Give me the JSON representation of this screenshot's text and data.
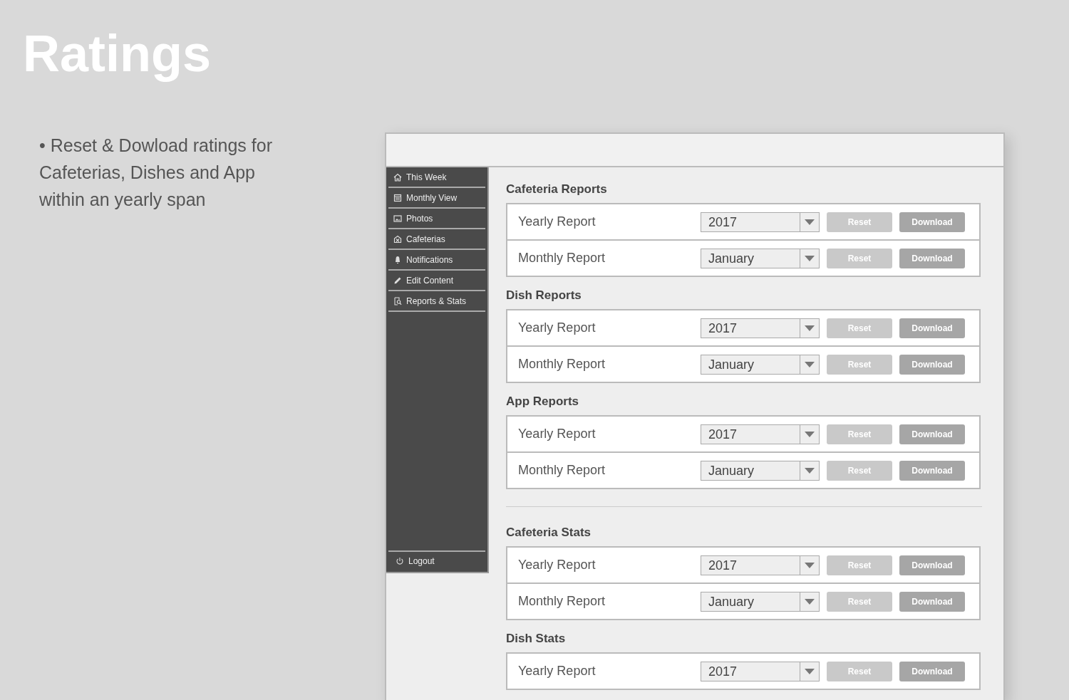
{
  "title": "Ratings",
  "description": "• Reset & Dowload ratings for Cafeterias, Dishes and App within an yearly span",
  "sidebar": {
    "items": [
      {
        "label": "This Week"
      },
      {
        "label": "Monthly View"
      },
      {
        "label": "Photos"
      },
      {
        "label": "Cafeterias"
      },
      {
        "label": "Notifications"
      },
      {
        "label": "Edit Content"
      },
      {
        "label": "Reports & Stats"
      }
    ],
    "logout": {
      "label": "Logout"
    }
  },
  "groups": [
    {
      "sections": [
        {
          "heading": "Cafeteria Reports",
          "rows": [
            {
              "label": "Yearly Report",
              "value": "2017",
              "reset": {
                "label": "Reset",
                "disabled": true
              },
              "download": {
                "label": "Download",
                "disabled": false
              }
            },
            {
              "label": "Monthly Report",
              "value": "January",
              "reset": {
                "label": "Reset",
                "disabled": true
              },
              "download": {
                "label": "Download",
                "disabled": false
              }
            }
          ]
        },
        {
          "heading": "Dish Reports",
          "rows": [
            {
              "label": "Yearly Report",
              "value": "2017",
              "reset": {
                "label": "Reset",
                "disabled": true
              },
              "download": {
                "label": "Download",
                "disabled": false
              }
            },
            {
              "label": "Monthly Report",
              "value": "January",
              "reset": {
                "label": "Reset",
                "disabled": true
              },
              "download": {
                "label": "Download",
                "disabled": false
              }
            }
          ]
        },
        {
          "heading": "App Reports",
          "rows": [
            {
              "label": "Yearly Report",
              "value": "2017",
              "reset": {
                "label": "Reset",
                "disabled": true
              },
              "download": {
                "label": "Download",
                "disabled": false
              }
            },
            {
              "label": "Monthly Report",
              "value": "January",
              "reset": {
                "label": "Reset",
                "disabled": true
              },
              "download": {
                "label": "Download",
                "disabled": false
              }
            }
          ]
        }
      ]
    },
    {
      "sections": [
        {
          "heading": "Cafeteria Stats",
          "rows": [
            {
              "label": "Yearly Report",
              "value": "2017",
              "reset": {
                "label": "Reset",
                "disabled": true
              },
              "download": {
                "label": "Download",
                "disabled": false
              }
            },
            {
              "label": "Monthly Report",
              "value": "January",
              "reset": {
                "label": "Reset",
                "disabled": true
              },
              "download": {
                "label": "Download",
                "disabled": false
              }
            }
          ]
        },
        {
          "heading": "Dish Stats",
          "rows": [
            {
              "label": "Yearly Report",
              "value": "2017",
              "reset": {
                "label": "Reset",
                "disabled": true
              },
              "download": {
                "label": "Download",
                "disabled": false
              }
            }
          ]
        }
      ]
    }
  ]
}
